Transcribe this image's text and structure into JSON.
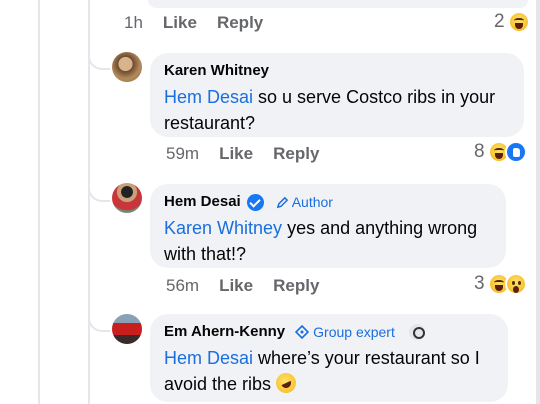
{
  "top_comment": {
    "time": "1h",
    "like_label": "Like",
    "reply_label": "Reply",
    "reaction_count": "2",
    "reactions": [
      "haha-emoji"
    ]
  },
  "comments": [
    {
      "author": "Karen Whitney",
      "mention": "Hem Desai",
      "text": " so u serve Costco ribs in your restaurant?",
      "time": "59m",
      "like_label": "Like",
      "reply_label": "Reply",
      "reaction_count": "8",
      "reactions": [
        "haha-emoji",
        "like-emoji"
      ]
    },
    {
      "author": "Hem Desai",
      "verified": true,
      "badge": "Author",
      "mention": "Karen Whitney",
      "text": " yes and anything wrong with that!?",
      "time": "56m",
      "like_label": "Like",
      "reply_label": "Reply",
      "reaction_count": "3",
      "reactions": [
        "haha-emoji",
        "wow-emoji"
      ]
    },
    {
      "author": "Em Ahern-Kenny",
      "badge": "Group expert",
      "mention": "Hem Desai",
      "text": " where’s your restaurant so I avoid the ribs",
      "emoji": "rofl-emoji"
    }
  ],
  "colors": {
    "link": "#1a6fe0",
    "bubble": "#f0f2f5",
    "meta": "#65676b",
    "verified": "#1877f2"
  }
}
